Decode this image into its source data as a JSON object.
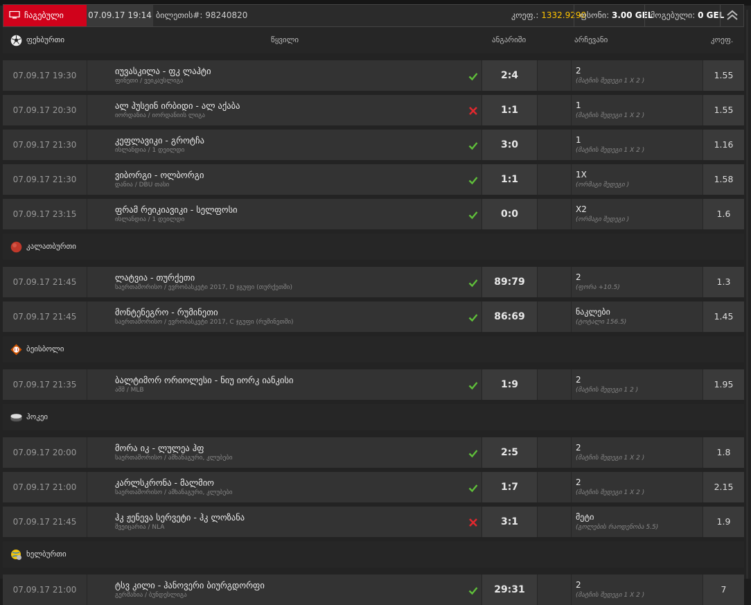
{
  "header": {
    "tab_label": "ჩაგებული",
    "datetime": "07.09.17 19:14",
    "ticket_label": "ბილეთის#:",
    "ticket_number": "98240820",
    "coef_label": "კოეფ.:",
    "coef_value": "1332.9290",
    "stake_label": "ფსონი:",
    "stake_value": "3.00 GEL",
    "win_label": "მოგებული:",
    "win_value": "0 GEL",
    "icons": {
      "tab": "monitor-icon",
      "collapse": "double-chevron-up-icon"
    },
    "colors": {
      "tab_bg": "#d0021b",
      "coef": "#ffc400"
    }
  },
  "columns": {
    "event": "წყვილი",
    "score": "ანგარიში",
    "bet": "არჩევანი",
    "odds": "კოეფ."
  },
  "sports": [
    {
      "name": "ფეხბურთი",
      "icon": "soccer-ball-icon",
      "matches": [
        {
          "time": "07.09.17 19:30",
          "name": "იუვასკილა - ფკ ლაჰტი",
          "league": "ფინეთი / ვეიკაუსლიგა",
          "result": "won",
          "score": "2:4",
          "bet": "2",
          "bet_desc": "(მატჩის შედეგი 1 X 2 )",
          "odd": "1.55"
        },
        {
          "time": "07.09.17 20:30",
          "name": "ალ ჰუსეინ ირბიდი - ალ აქაბა",
          "league": "იორდანია / იორდანიის ლიგა",
          "result": "lost",
          "score": "1:1",
          "bet": "1",
          "bet_desc": "(მატჩის შედეგი 1 X 2 )",
          "odd": "1.55"
        },
        {
          "time": "07.09.17 21:30",
          "name": "კეფლავიკი - გროტჩა",
          "league": "ისლანდია / 1 დეილდი",
          "result": "won",
          "score": "3:0",
          "bet": "1",
          "bet_desc": "(მატჩის შედეგი 1 X 2 )",
          "odd": "1.16"
        },
        {
          "time": "07.09.17 21:30",
          "name": "ვიბორგი - ოლბორგი",
          "league": "დანია / DBU თასი",
          "result": "won",
          "score": "1:1",
          "bet": "1X",
          "bet_desc": "(ორმაგი შედეგი )",
          "odd": "1.58"
        },
        {
          "time": "07.09.17 23:15",
          "name": "ფრამ რეიკიავიკი - სელფოსი",
          "league": "ისლანდია / 1 დეილდი",
          "result": "won",
          "score": "0:0",
          "bet": "X2",
          "bet_desc": "(ორმაგი შედეგი )",
          "odd": "1.6"
        }
      ]
    },
    {
      "name": "კალათბურთი",
      "icon": "basketball-icon",
      "matches": [
        {
          "time": "07.09.17 21:45",
          "name": "ლატვია - თურქეთი",
          "league": "საერთაშორისო / ევრობასკეტი 2017, D ჯგუფი (თურქეთში)",
          "result": "won",
          "score": "89:79",
          "bet": "2",
          "bet_desc": "(ფორა +10.5)",
          "odd": "1.3"
        },
        {
          "time": "07.09.17 21:45",
          "name": "მონტენეგრო - რუმინეთი",
          "league": "საერთაშორისო / ევრობასკეტი 2017, C ჯგუფი (რუმინეთში)",
          "result": "won",
          "score": "86:69",
          "bet": "ნაკლები",
          "bet_desc": "(ტოტალი 156.5)",
          "odd": "1.45"
        }
      ]
    },
    {
      "name": "ბეისბოლი",
      "icon": "baseball-icon",
      "matches": [
        {
          "time": "07.09.17 21:35",
          "name": "ბალტიმორ ორიოლესი - ნიუ იორკ იანკისი",
          "league": "აშშ / MLB",
          "result": "won",
          "score": "1:9",
          "bet": "2",
          "bet_desc": "(მატჩის შედეგი 1 2 )",
          "odd": "1.95"
        }
      ]
    },
    {
      "name": "ჰოკეი",
      "icon": "hockey-puck-icon",
      "matches": [
        {
          "time": "07.09.17 20:00",
          "name": "მორა იკ - ლულეა ჰფ",
          "league": "საერთაშორისო / ამხანაგური, კლუბები",
          "result": "won",
          "score": "2:5",
          "bet": "2",
          "bet_desc": "(მატჩის შედეგი 1 X 2 )",
          "odd": "1.8"
        },
        {
          "time": "07.09.17 21:00",
          "name": "კარლსკრონა - მალმიო",
          "league": "საერთაშორისო / ამხანაგური, კლუბები",
          "result": "won",
          "score": "1:7",
          "bet": "2",
          "bet_desc": "(მატჩის შედეგი 1 X 2 )",
          "odd": "2.15"
        },
        {
          "time": "07.09.17 21:45",
          "name": "ჰკ ჟენევა სერვეტი - ჰკ ლოზანა",
          "league": "შვეიცარია / NLA",
          "result": "lost",
          "score": "3:1",
          "bet": "მეტი",
          "bet_desc": "(გოლების რაოდენობა 5.5)",
          "odd": "1.9"
        }
      ]
    },
    {
      "name": "ხელბურთი",
      "icon": "handball-icon",
      "matches": [
        {
          "time": "07.09.17 21:00",
          "name": "ტსვ კილი - ჰანოვერი ბიურგდორფი",
          "league": "გერმანია / ბუნდესლიგა",
          "result": "won",
          "score": "29:31",
          "bet": "2",
          "bet_desc": "(მატჩის შედეგი 1 X 2 )",
          "odd": "7"
        }
      ]
    }
  ]
}
